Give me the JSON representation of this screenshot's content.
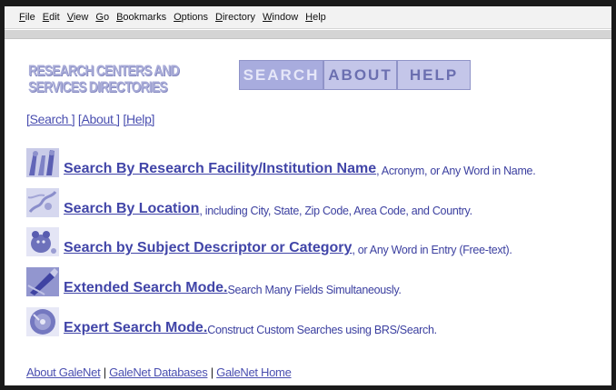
{
  "menubar": {
    "items": [
      {
        "first": "F",
        "rest": "ile"
      },
      {
        "first": "E",
        "rest": "dit"
      },
      {
        "first": "V",
        "rest": "iew"
      },
      {
        "first": "G",
        "rest": "o"
      },
      {
        "first": "B",
        "rest": "ookmarks"
      },
      {
        "first": "O",
        "rest": "ptions"
      },
      {
        "first": "D",
        "rest": "irectory"
      },
      {
        "first": "W",
        "rest": "indow"
      },
      {
        "first": "H",
        "rest": "elp"
      }
    ]
  },
  "header": {
    "logo_line1": "RESEARCH CENTERS AND",
    "logo_line2": "SERVICES DIRECTORIES",
    "nav_search": "SEARCH",
    "nav_about": "ABOUT",
    "nav_help": "HELP"
  },
  "textlinks": {
    "search": "[Search ]",
    "about": "[About ]",
    "help": "[Help]"
  },
  "search_options": [
    {
      "link": "Search By Research Facility/Institution Name",
      "desc": ", Acronym, or Any Word in Name.",
      "icon": "people-icon"
    },
    {
      "link": "Search By Location",
      "desc": ", including City, State, Zip Code, Area Code, and Country.",
      "icon": "map-icon"
    },
    {
      "link": "Search by Subject Descriptor or Category",
      "desc": ", or Any Word in Entry (Free-text).",
      "icon": "bear-icon"
    },
    {
      "link": "Extended Search Mode.",
      "desc": " Search Many Fields Simultaneously.",
      "icon": "pen-icon"
    },
    {
      "link": "Expert Search Mode.",
      "desc": " Construct Custom Searches using BRS/Search.",
      "icon": "disc-icon"
    }
  ],
  "footer": {
    "about": "About GaleNet",
    "databases": "GaleNet Databases",
    "home": "GaleNet Home",
    "sep": "|"
  },
  "colors": {
    "link": "#4145a8",
    "logo": "#a9acd8",
    "nav_button": "#b6b9e0"
  }
}
